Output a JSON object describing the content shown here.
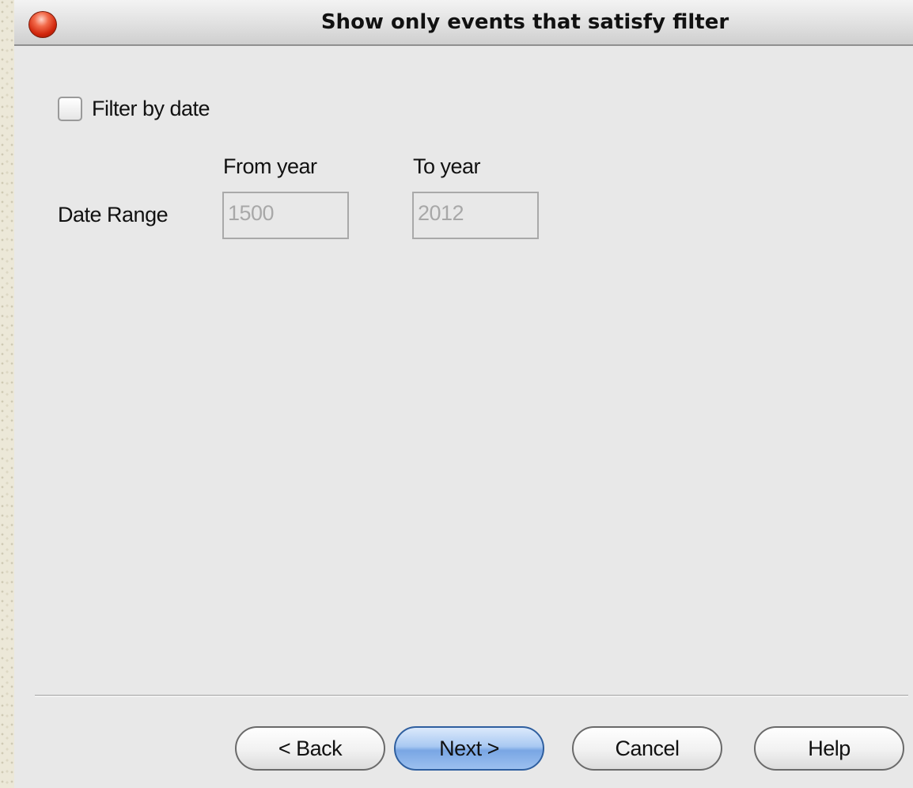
{
  "window": {
    "title": "Show only events that satisfy filter"
  },
  "filter": {
    "checkbox_label": "Filter by date",
    "checked": false
  },
  "date_range": {
    "label": "Date Range",
    "from_label": "From year",
    "to_label": "To year",
    "from_value": "1500",
    "to_value": "2012",
    "enabled": false
  },
  "buttons": {
    "back": "< Back",
    "next": "Next >",
    "cancel": "Cancel",
    "help": "Help"
  },
  "colors": {
    "window_bg": "#e8e8e8",
    "close_button": "#d0260c",
    "next_button": "#79a6e4"
  }
}
